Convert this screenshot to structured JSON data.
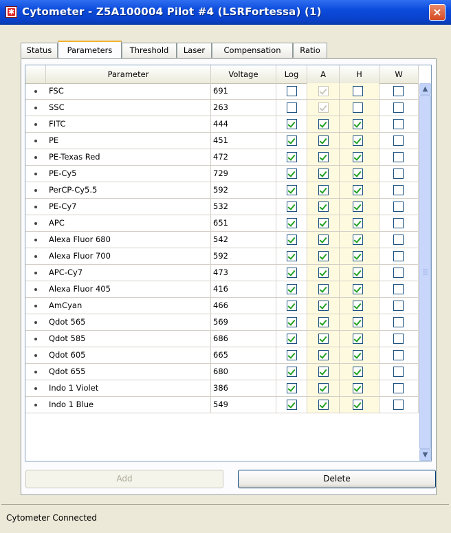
{
  "window": {
    "title": "Cytometer - Z5A100004 Pilot #4 (LSRFortessa) (1)",
    "close_symbol": "×",
    "icon": "cytometer-app-icon",
    "title_bar_color": "#0a40c6"
  },
  "tabs": [
    {
      "label": "Status"
    },
    {
      "label": "Parameters",
      "active": true
    },
    {
      "label": "Threshold"
    },
    {
      "label": "Laser"
    },
    {
      "label": "Compensation"
    },
    {
      "label": "Ratio"
    }
  ],
  "grid": {
    "columns": [
      "Parameter",
      "Voltage",
      "Log",
      "A",
      "H",
      "W"
    ],
    "rows": [
      {
        "name": "FSC",
        "voltage": "691",
        "log": false,
        "a": true,
        "h": false,
        "w": false,
        "a_disabled": true
      },
      {
        "name": "SSC",
        "voltage": "263",
        "log": false,
        "a": true,
        "h": false,
        "w": false,
        "a_disabled": true
      },
      {
        "name": "FITC",
        "voltage": "444",
        "log": true,
        "a": true,
        "h": true,
        "w": false
      },
      {
        "name": "PE",
        "voltage": "451",
        "log": true,
        "a": true,
        "h": true,
        "w": false
      },
      {
        "name": "PE-Texas Red",
        "voltage": "472",
        "log": true,
        "a": true,
        "h": true,
        "w": false
      },
      {
        "name": "PE-Cy5",
        "voltage": "729",
        "log": true,
        "a": true,
        "h": true,
        "w": false
      },
      {
        "name": "PerCP-Cy5.5",
        "voltage": "592",
        "log": true,
        "a": true,
        "h": true,
        "w": false
      },
      {
        "name": "PE-Cy7",
        "voltage": "532",
        "log": true,
        "a": true,
        "h": true,
        "w": false
      },
      {
        "name": "APC",
        "voltage": "651",
        "log": true,
        "a": true,
        "h": true,
        "w": false
      },
      {
        "name": "Alexa Fluor 680",
        "voltage": "542",
        "log": true,
        "a": true,
        "h": true,
        "w": false
      },
      {
        "name": "Alexa Fluor 700",
        "voltage": "592",
        "log": true,
        "a": true,
        "h": true,
        "w": false
      },
      {
        "name": "APC-Cy7",
        "voltage": "473",
        "log": true,
        "a": true,
        "h": true,
        "w": false
      },
      {
        "name": "Alexa Fluor 405",
        "voltage": "416",
        "log": true,
        "a": true,
        "h": true,
        "w": false
      },
      {
        "name": "AmCyan",
        "voltage": "466",
        "log": true,
        "a": true,
        "h": true,
        "w": false
      },
      {
        "name": "Qdot 565",
        "voltage": "569",
        "log": true,
        "a": true,
        "h": true,
        "w": false
      },
      {
        "name": "Qdot 585",
        "voltage": "686",
        "log": true,
        "a": true,
        "h": true,
        "w": false
      },
      {
        "name": "Qdot 605",
        "voltage": "665",
        "log": true,
        "a": true,
        "h": true,
        "w": false
      },
      {
        "name": "Qdot 655",
        "voltage": "680",
        "log": true,
        "a": true,
        "h": true,
        "w": false
      },
      {
        "name": "Indo 1 Violet",
        "voltage": "386",
        "log": true,
        "a": true,
        "h": true,
        "w": false
      },
      {
        "name": "Indo 1 Blue",
        "voltage": "549",
        "log": true,
        "a": true,
        "h": true,
        "w": false
      }
    ]
  },
  "scrollbar": {
    "up_icon": "▲",
    "down_icon": "▼"
  },
  "buttons": {
    "add": "Add",
    "add_disabled": true,
    "delete": "Delete"
  },
  "status": {
    "text": "Cytometer Connected"
  }
}
